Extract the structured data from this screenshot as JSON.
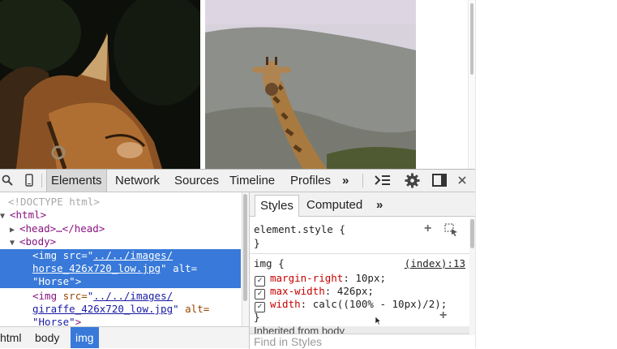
{
  "toolbar": {
    "tabs": [
      "Elements",
      "Network",
      "Sources",
      "Timeline",
      "Profiles"
    ],
    "more": "»"
  },
  "dom": {
    "doctype": "<!DOCTYPE html>",
    "html_open": "<html>",
    "head": "<head>…</head>",
    "body_open": "<body>",
    "img1": {
      "open": "<img ",
      "src_attr": "src=",
      "src_q1": "\"",
      "src_val1": "../../images/",
      "src_val2": "horse_426x720_low.jpg",
      "src_q2": "\"",
      "alt_attr": " alt=",
      "alt_val": "\"Horse\"",
      "close": ">"
    },
    "img2": {
      "open": "<img ",
      "src_attr": "src=",
      "src_q1": "\"",
      "src_val1": "../../images/",
      "src_val2": "giraffe_426x720_low.jpg",
      "src_q2": "\"",
      "alt_attr": " alt=",
      "alt_val": "\"Horse\"",
      "close": ">"
    }
  },
  "breadcrumbs": [
    "html",
    "body",
    "img"
  ],
  "styles": {
    "tabs": [
      "Styles",
      "Computed"
    ],
    "more": "»",
    "element_style": "element.style {",
    "close_brace": "}",
    "rule_selector": "img {",
    "rule_source": "(index):13",
    "declarations": [
      {
        "prop": "margin-right",
        "value": "10px;"
      },
      {
        "prop": "max-width",
        "value": "426px;"
      },
      {
        "prop": "width",
        "value": "calc((100% - 10px)/2);"
      }
    ],
    "inherited": "Inherited from body",
    "find_placeholder": "Find in Styles"
  }
}
